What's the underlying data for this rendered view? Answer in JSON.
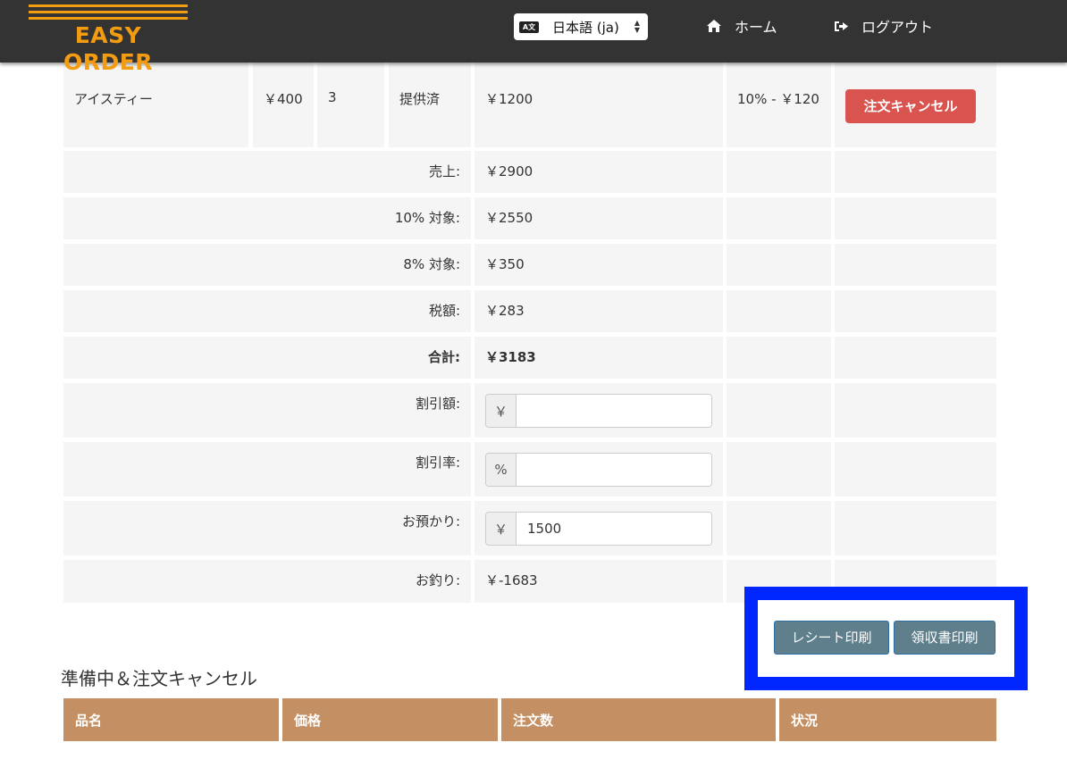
{
  "navbar": {
    "logo_text": "EASY ORDER",
    "logo_color": "#f39c12",
    "language_select": {
      "icon": "translate-icon",
      "selected": "日本語 (ja)"
    },
    "home": {
      "icon": "home-icon",
      "label": "ホーム"
    },
    "logout": {
      "icon": "sign-out-icon",
      "label": "ログアウト"
    }
  },
  "order_row": {
    "item": "アイスティー",
    "price": "￥400",
    "quantity": "3",
    "status": "提供済",
    "amount": "￥1200",
    "tax": "10% - ￥120",
    "cancel_label": "注文キャンセル"
  },
  "summary": {
    "sales_label": "売上:",
    "sales_value": "￥2900",
    "ten_label": "10% 対象:",
    "ten_value": "￥2550",
    "eight_label": "8% 対象:",
    "eight_value": "￥350",
    "tax_label": "税額:",
    "tax_value": "￥283",
    "total_label": "合計:",
    "total_value": "￥3183",
    "discount_amount_label": "割引額:",
    "discount_amount_addon": "￥",
    "discount_amount_value": "",
    "discount_rate_label": "割引率:",
    "discount_rate_addon": "%",
    "discount_rate_value": "",
    "deposit_label": "お預かり:",
    "deposit_addon": "￥",
    "deposit_value": "1500",
    "change_label": "お釣り:",
    "change_value": "￥-1683"
  },
  "print": {
    "receipt_label": "レシート印刷",
    "invoice_label": "領収書印刷",
    "highlight_color": "#0026ff"
  },
  "pending_section": {
    "title": "準備中＆注文キャンセル",
    "headers": [
      "品名",
      "価格",
      "注文数",
      "状況"
    ]
  }
}
